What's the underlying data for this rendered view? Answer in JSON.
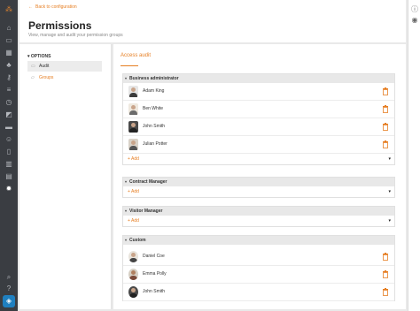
{
  "header": {
    "back_label": "Back to configuration",
    "title": "Permissions",
    "subtitle": "View, manage and audit your permission groups"
  },
  "options": {
    "heading": "OPTIONS",
    "items": [
      {
        "label": "Audit",
        "icon": "document-icon"
      },
      {
        "label": "Groups",
        "icon": "folder-icon"
      }
    ]
  },
  "main": {
    "tab_label": "Access audit",
    "add_label": "+ Add",
    "sections": [
      {
        "name": "Business administrator",
        "users": [
          "Adam King",
          "Ben White",
          "John Smith",
          "Julian Potter"
        ]
      },
      {
        "name": "Contract Manager",
        "users": []
      },
      {
        "name": "Visitor Manager",
        "users": []
      },
      {
        "name": "Custom",
        "users": [
          "Daniel Coe",
          "Emma Polly",
          "John Smith"
        ]
      }
    ]
  },
  "colors": {
    "accent": "#e67e22",
    "rail": "#3a3d42",
    "section_header": "#e8e8e8"
  }
}
